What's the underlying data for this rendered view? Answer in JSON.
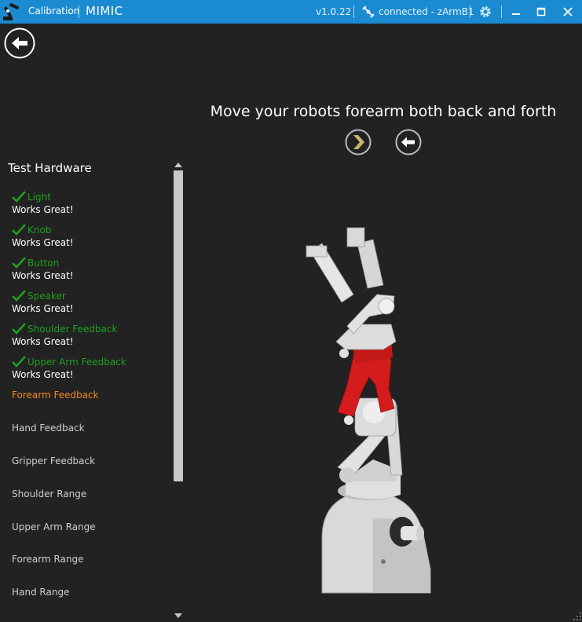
{
  "titlebar": {
    "app_name": "Calibration",
    "title": "MIMIC",
    "version": "v1.0.22",
    "connection": "connected - zArmB1"
  },
  "instruction": "Move your robots forearm both back and forth",
  "list": {
    "title": "Test Hardware",
    "completed": [
      {
        "name": "Light",
        "status": "Works Great!"
      },
      {
        "name": "Knob",
        "status": "Works Great!"
      },
      {
        "name": "Button",
        "status": "Works Great!"
      },
      {
        "name": "Speaker",
        "status": "Works Great!"
      },
      {
        "name": "Shoulder Feedback",
        "status": "Works Great!"
      },
      {
        "name": "Upper Arm Feedback",
        "status": "Works Great!"
      }
    ],
    "active": "Forearm Feedback",
    "pending": [
      "Hand Feedback",
      "Gripper Feedback",
      "Shoulder Range",
      "Upper Arm Range",
      "Forearm Range",
      "Hand Range"
    ]
  },
  "colors": {
    "titlebar": "#1b8bd1",
    "background": "#222222",
    "success": "#1ea01e",
    "active": "#f28a1e",
    "next_arrow": "#c8b46a",
    "robot_highlight": "#d41c1c"
  },
  "icons": [
    "robot-arm-icon",
    "connection-icon",
    "gear-icon",
    "minimize-icon",
    "maximize-icon",
    "close-icon",
    "back-arrow-icon",
    "next-arrow-icon",
    "check-icon"
  ]
}
